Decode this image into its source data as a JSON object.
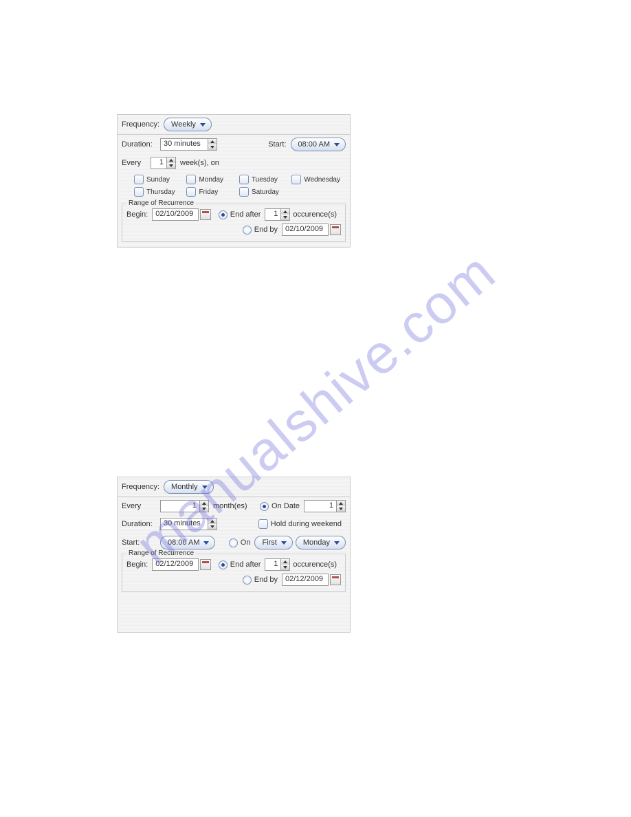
{
  "watermark": "manualshive.com",
  "weekly": {
    "frequency_label": "Frequency:",
    "frequency_value": "Weekly",
    "duration_label": "Duration:",
    "duration_value": "30 minutes",
    "start_label": "Start:",
    "start_value": "08:00 AM",
    "every_label": "Every",
    "every_value": "1",
    "weeks_on_label": "week(s), on",
    "days": [
      "Sunday",
      "Monday",
      "Tuesday",
      "Wednesday",
      "Thursday",
      "Friday",
      "Saturday"
    ],
    "range_label": "Range of Recurrence",
    "begin_label": "Begin:",
    "begin_value": "02/10/2009",
    "end_after_label": "End after",
    "end_after_value": "1",
    "occurrences_label": "occurence(s)",
    "end_by_label": "End by",
    "end_by_value": "02/10/2009"
  },
  "monthly": {
    "frequency_label": "Frequency:",
    "frequency_value": "Monthly",
    "every_label": "Every",
    "every_value": "1",
    "months_label": "month(es)",
    "on_date_label": "On Date",
    "on_date_value": "1",
    "duration_label": "Duration:",
    "duration_value": "30 minutes",
    "hold_weekend_label": "Hold during weekend",
    "start_label": "Start:",
    "start_value": "08:00 AM",
    "on_label": "On",
    "on_ordinal": "First",
    "on_day": "Monday",
    "range_label": "Range of Recurrence",
    "begin_label": "Begin:",
    "begin_value": "02/12/2009",
    "end_after_label": "End after",
    "end_after_value": "1",
    "occurrences_label": "occurence(s)",
    "end_by_label": "End by",
    "end_by_value": "02/12/2009"
  }
}
